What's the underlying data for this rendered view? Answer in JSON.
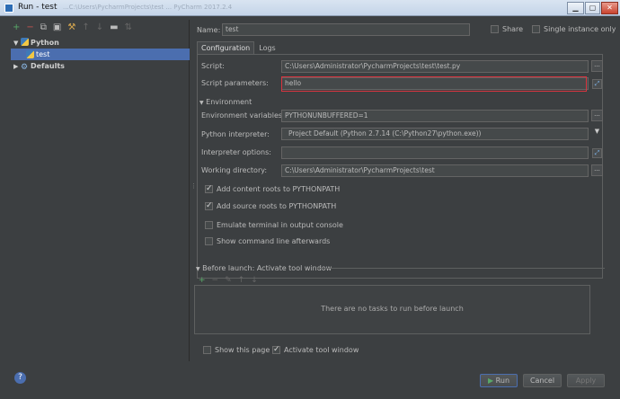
{
  "window": {
    "title": "Run - test",
    "blurred_title": "...C:\\Users\\PycharmProjects\\test ... PyCharm 2017.2.4",
    "minimize": "▁",
    "maximize": "▢",
    "close": "✕"
  },
  "left_toolbar": {
    "icons": [
      "plus-icon",
      "minus-icon",
      "copy-icon",
      "save-icon",
      "wrench-icon",
      "up-icon",
      "down-icon",
      "folder-icon",
      "sort-icon"
    ]
  },
  "tree": {
    "python": "Python",
    "test": "test",
    "defaults": "Defaults"
  },
  "form": {
    "name_label": "Name:",
    "name_value": "test",
    "share_label": "Share",
    "single_instance_label": "Single instance only"
  },
  "tabs": [
    "Configuration",
    "Logs"
  ],
  "config": {
    "script_label": "Script:",
    "script_value": "C:\\Users\\Administrator\\PycharmProjects\\test\\test.py",
    "params_label": "Script parameters:",
    "params_value": "hello",
    "env_header": "Environment",
    "env_vars_label": "Environment variables:",
    "env_vars_value": "PYTHONUNBUFFERED=1",
    "interp_label": "Python interpreter:",
    "interp_value": "Project Default (Python 2.7.14 (C:\\Python27\\python.exe))",
    "interp_opts_label": "Interpreter options:",
    "interp_opts_value": "",
    "workdir_label": "Working directory:",
    "workdir_value": "C:\\Users\\Administrator\\PycharmProjects\\test",
    "add_content_roots": "Add content roots to PYTHONPATH",
    "add_source_roots": "Add source roots to PYTHONPATH",
    "emulate_terminal": "Emulate terminal in output console",
    "show_cmd": "Show command line afterwards",
    "dots": "..."
  },
  "before_launch": {
    "header": "Before launch: Activate tool window",
    "empty_text": "There are no tasks to run before launch",
    "show_page": "Show this page",
    "activate_tool_window": "Activate tool window"
  },
  "buttons": {
    "run": "Run",
    "cancel": "Cancel",
    "apply": "Apply",
    "help": "?"
  },
  "colors": {
    "selection": "#4b6eaf",
    "highlight_box": "#d9343f",
    "accent_green": "#59a869",
    "accent_red": "#c75450"
  }
}
